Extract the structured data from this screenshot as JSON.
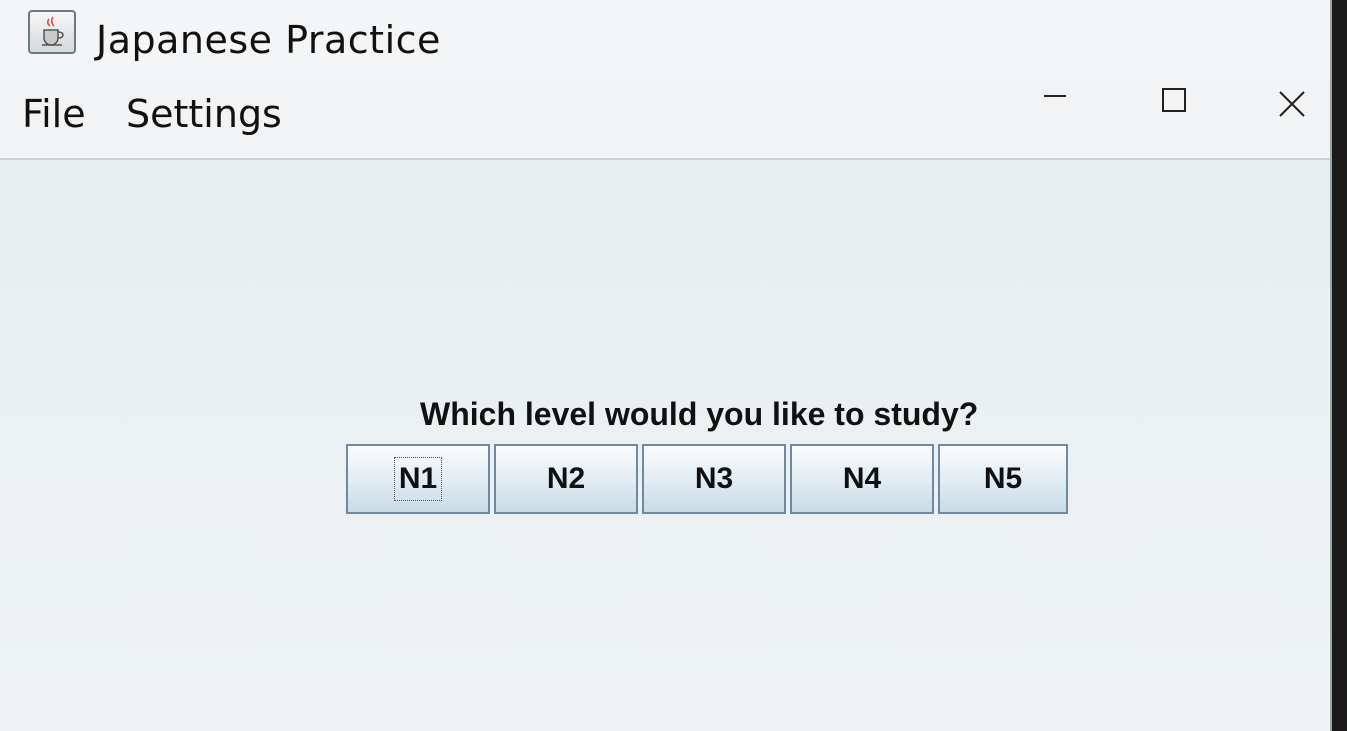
{
  "window": {
    "title": "Japanese Practice",
    "app_icon": "java-cup-icon",
    "controls": [
      "minimize-icon",
      "maximize-icon",
      "close-icon"
    ]
  },
  "menubar": {
    "items": [
      {
        "label": "File"
      },
      {
        "label": "Settings"
      }
    ]
  },
  "main": {
    "prompt": "Which level would you like to study?",
    "levels": [
      {
        "label": "N1"
      },
      {
        "label": "N2"
      },
      {
        "label": "N3"
      },
      {
        "label": "N4"
      },
      {
        "label": "N5"
      }
    ]
  }
}
